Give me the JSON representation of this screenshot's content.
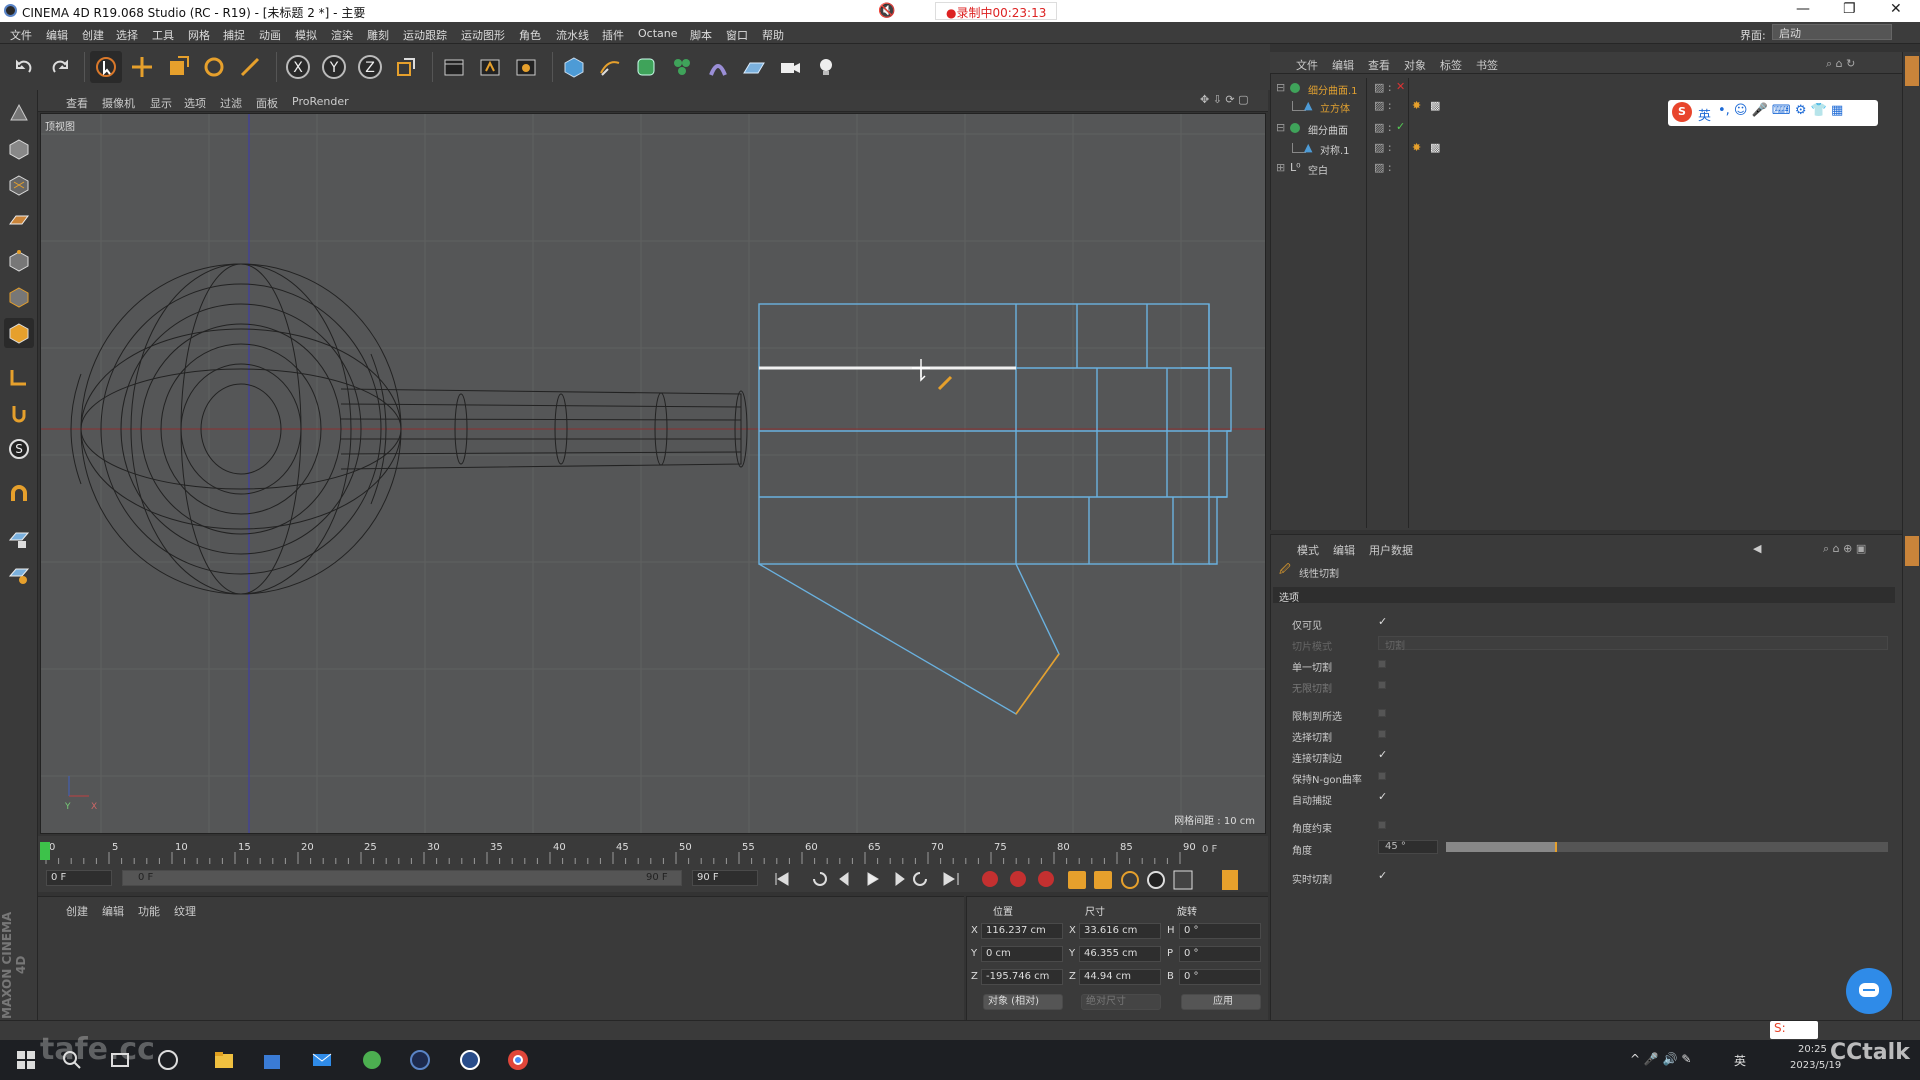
{
  "app": {
    "title": "CINEMA 4D R19.068 Studio (RC - R19) - [未标题 2 *] - 主要",
    "recording": "●录制中00:23:13",
    "layout_label": "界面:",
    "layout_value": "启动"
  },
  "menu": [
    "文件",
    "编辑",
    "创建",
    "选择",
    "工具",
    "网格",
    "捕捉",
    "动画",
    "模拟",
    "渲染",
    "雕刻",
    "运动跟踪",
    "运动图形",
    "角色",
    "流水线",
    "插件",
    "Octane",
    "脚本",
    "窗口",
    "帮助"
  ],
  "viewport": {
    "menu": [
      "查看",
      "摄像机",
      "显示",
      "选项",
      "过滤",
      "面板",
      "ProRender"
    ],
    "label": "顶视图",
    "grid": "网格间距 : 10 cm"
  },
  "timeline": {
    "ticks": [
      "0",
      "5",
      "10",
      "15",
      "20",
      "25",
      "30",
      "35",
      "40",
      "45",
      "50",
      "55",
      "60",
      "65",
      "70",
      "75",
      "80",
      "85",
      "90"
    ],
    "end_frame": "0 F",
    "start": "0 F",
    "range_start": "0 F",
    "range_end": "90 F",
    "max": "90 F"
  },
  "materials": {
    "tabs": [
      "创建",
      "编辑",
      "功能",
      "纹理"
    ]
  },
  "coords": {
    "headers": [
      "位置",
      "尺寸",
      "旋转"
    ],
    "rows": [
      {
        "axis": "X",
        "pos": "116.237 cm",
        "saxis": "X",
        "size": "33.616 cm",
        "raxis": "H",
        "rot": "0 °"
      },
      {
        "axis": "Y",
        "pos": "0 cm",
        "saxis": "Y",
        "size": "46.355 cm",
        "raxis": "P",
        "rot": "0 °"
      },
      {
        "axis": "Z",
        "pos": "-195.746 cm",
        "saxis": "Z",
        "size": "44.94 cm",
        "raxis": "B",
        "rot": "0 °"
      }
    ],
    "mode": "对象 (相对)",
    "size_mode": "绝对尺寸",
    "apply": "应用"
  },
  "objects": {
    "menu": [
      "文件",
      "编辑",
      "查看",
      "对象",
      "标签",
      "书签"
    ],
    "rows": [
      {
        "name": "细分曲面.1",
        "color": "#e0a030"
      },
      {
        "name": "立方体",
        "color": "#e0a030"
      },
      {
        "name": "细分曲面",
        "color": "#cfcfcf"
      },
      {
        "name": "对称.1",
        "color": "#cfcfcf"
      },
      {
        "name": "空白",
        "color": "#cfcfcf"
      }
    ]
  },
  "attributes": {
    "menu": [
      "模式",
      "编辑",
      "用户数据"
    ],
    "tool": "线性切割",
    "section": "选项",
    "fields": [
      {
        "label": "仅可见",
        "state": "checked"
      },
      {
        "label": "切片模式",
        "state": "dropdown",
        "value": "切割"
      },
      {
        "label": "单一切割",
        "state": "off"
      },
      {
        "label": "无限切割",
        "state": "off"
      },
      {
        "label": "限制到所选",
        "state": "off"
      },
      {
        "label": "选择切割",
        "state": "off"
      },
      {
        "label": "连接切割边",
        "state": "checked"
      },
      {
        "label": "保持N-gon曲率",
        "state": "off"
      },
      {
        "label": "自动捕捉",
        "state": "checked"
      },
      {
        "label": "角度约束",
        "state": "off"
      },
      {
        "label": "角度",
        "state": "slider",
        "value": "45 °",
        "fraction": 0.25
      },
      {
        "label": "实时切割",
        "state": "checked"
      }
    ]
  },
  "taskbar": {
    "time": "20:25",
    "date": "2023/5/19",
    "lang": "英"
  },
  "watermark": "tafe.cc",
  "watermark2": "CCtalk",
  "side_logo": "MAXON CINEMA 4D",
  "colors": {
    "accent": "#5fa8d8",
    "select": "#e0a030",
    "red_axis": "#c03030",
    "blue_axis": "#3040c0"
  }
}
